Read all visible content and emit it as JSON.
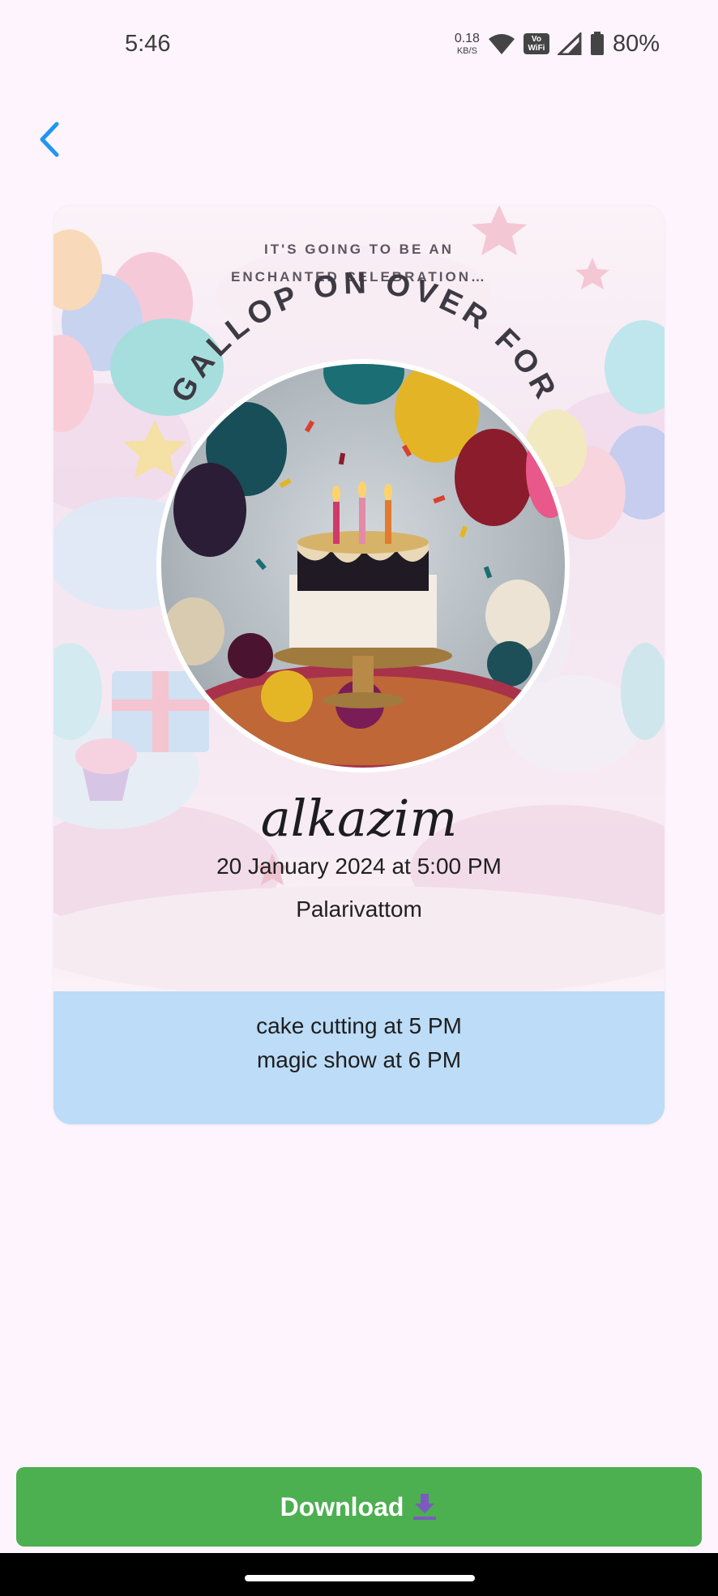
{
  "status_bar": {
    "time": "5:46",
    "net_speed_value": "0.18",
    "net_speed_unit": "KB/S",
    "volte_label": "Vo WiFi",
    "battery": "80%"
  },
  "invitation": {
    "tagline_line1": "IT'S GOING TO BE AN",
    "tagline_line2": "ENCHANTED CELEBRATION…",
    "arc_text": "GALLOP ON OVER FOR",
    "name": "alkazim",
    "date": "20 January 2024 at 5:00 PM",
    "place": "Palarivattom"
  },
  "schedule": {
    "line1": "cake cutting at 5 PM",
    "line2": "magic show at 6 PM"
  },
  "download": {
    "label": "Download",
    "icon": "download-icon",
    "color": "#4caf50"
  }
}
